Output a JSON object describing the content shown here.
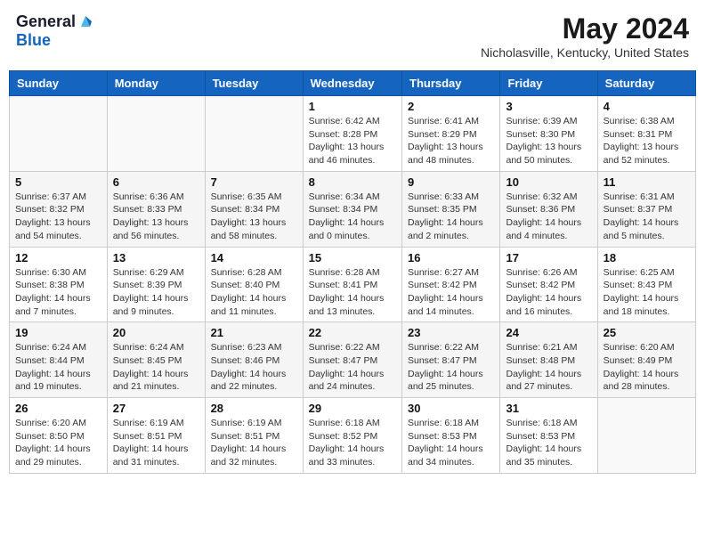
{
  "header": {
    "logo_general": "General",
    "logo_blue": "Blue",
    "month_year": "May 2024",
    "location": "Nicholasville, Kentucky, United States"
  },
  "days_of_week": [
    "Sunday",
    "Monday",
    "Tuesday",
    "Wednesday",
    "Thursday",
    "Friday",
    "Saturday"
  ],
  "weeks": [
    [
      {
        "day": "",
        "info": ""
      },
      {
        "day": "",
        "info": ""
      },
      {
        "day": "",
        "info": ""
      },
      {
        "day": "1",
        "info": "Sunrise: 6:42 AM\nSunset: 8:28 PM\nDaylight: 13 hours and 46 minutes."
      },
      {
        "day": "2",
        "info": "Sunrise: 6:41 AM\nSunset: 8:29 PM\nDaylight: 13 hours and 48 minutes."
      },
      {
        "day": "3",
        "info": "Sunrise: 6:39 AM\nSunset: 8:30 PM\nDaylight: 13 hours and 50 minutes."
      },
      {
        "day": "4",
        "info": "Sunrise: 6:38 AM\nSunset: 8:31 PM\nDaylight: 13 hours and 52 minutes."
      }
    ],
    [
      {
        "day": "5",
        "info": "Sunrise: 6:37 AM\nSunset: 8:32 PM\nDaylight: 13 hours and 54 minutes."
      },
      {
        "day": "6",
        "info": "Sunrise: 6:36 AM\nSunset: 8:33 PM\nDaylight: 13 hours and 56 minutes."
      },
      {
        "day": "7",
        "info": "Sunrise: 6:35 AM\nSunset: 8:34 PM\nDaylight: 13 hours and 58 minutes."
      },
      {
        "day": "8",
        "info": "Sunrise: 6:34 AM\nSunset: 8:34 PM\nDaylight: 14 hours and 0 minutes."
      },
      {
        "day": "9",
        "info": "Sunrise: 6:33 AM\nSunset: 8:35 PM\nDaylight: 14 hours and 2 minutes."
      },
      {
        "day": "10",
        "info": "Sunrise: 6:32 AM\nSunset: 8:36 PM\nDaylight: 14 hours and 4 minutes."
      },
      {
        "day": "11",
        "info": "Sunrise: 6:31 AM\nSunset: 8:37 PM\nDaylight: 14 hours and 5 minutes."
      }
    ],
    [
      {
        "day": "12",
        "info": "Sunrise: 6:30 AM\nSunset: 8:38 PM\nDaylight: 14 hours and 7 minutes."
      },
      {
        "day": "13",
        "info": "Sunrise: 6:29 AM\nSunset: 8:39 PM\nDaylight: 14 hours and 9 minutes."
      },
      {
        "day": "14",
        "info": "Sunrise: 6:28 AM\nSunset: 8:40 PM\nDaylight: 14 hours and 11 minutes."
      },
      {
        "day": "15",
        "info": "Sunrise: 6:28 AM\nSunset: 8:41 PM\nDaylight: 14 hours and 13 minutes."
      },
      {
        "day": "16",
        "info": "Sunrise: 6:27 AM\nSunset: 8:42 PM\nDaylight: 14 hours and 14 minutes."
      },
      {
        "day": "17",
        "info": "Sunrise: 6:26 AM\nSunset: 8:42 PM\nDaylight: 14 hours and 16 minutes."
      },
      {
        "day": "18",
        "info": "Sunrise: 6:25 AM\nSunset: 8:43 PM\nDaylight: 14 hours and 18 minutes."
      }
    ],
    [
      {
        "day": "19",
        "info": "Sunrise: 6:24 AM\nSunset: 8:44 PM\nDaylight: 14 hours and 19 minutes."
      },
      {
        "day": "20",
        "info": "Sunrise: 6:24 AM\nSunset: 8:45 PM\nDaylight: 14 hours and 21 minutes."
      },
      {
        "day": "21",
        "info": "Sunrise: 6:23 AM\nSunset: 8:46 PM\nDaylight: 14 hours and 22 minutes."
      },
      {
        "day": "22",
        "info": "Sunrise: 6:22 AM\nSunset: 8:47 PM\nDaylight: 14 hours and 24 minutes."
      },
      {
        "day": "23",
        "info": "Sunrise: 6:22 AM\nSunset: 8:47 PM\nDaylight: 14 hours and 25 minutes."
      },
      {
        "day": "24",
        "info": "Sunrise: 6:21 AM\nSunset: 8:48 PM\nDaylight: 14 hours and 27 minutes."
      },
      {
        "day": "25",
        "info": "Sunrise: 6:20 AM\nSunset: 8:49 PM\nDaylight: 14 hours and 28 minutes."
      }
    ],
    [
      {
        "day": "26",
        "info": "Sunrise: 6:20 AM\nSunset: 8:50 PM\nDaylight: 14 hours and 29 minutes."
      },
      {
        "day": "27",
        "info": "Sunrise: 6:19 AM\nSunset: 8:51 PM\nDaylight: 14 hours and 31 minutes."
      },
      {
        "day": "28",
        "info": "Sunrise: 6:19 AM\nSunset: 8:51 PM\nDaylight: 14 hours and 32 minutes."
      },
      {
        "day": "29",
        "info": "Sunrise: 6:18 AM\nSunset: 8:52 PM\nDaylight: 14 hours and 33 minutes."
      },
      {
        "day": "30",
        "info": "Sunrise: 6:18 AM\nSunset: 8:53 PM\nDaylight: 14 hours and 34 minutes."
      },
      {
        "day": "31",
        "info": "Sunrise: 6:18 AM\nSunset: 8:53 PM\nDaylight: 14 hours and 35 minutes."
      },
      {
        "day": "",
        "info": ""
      }
    ]
  ]
}
